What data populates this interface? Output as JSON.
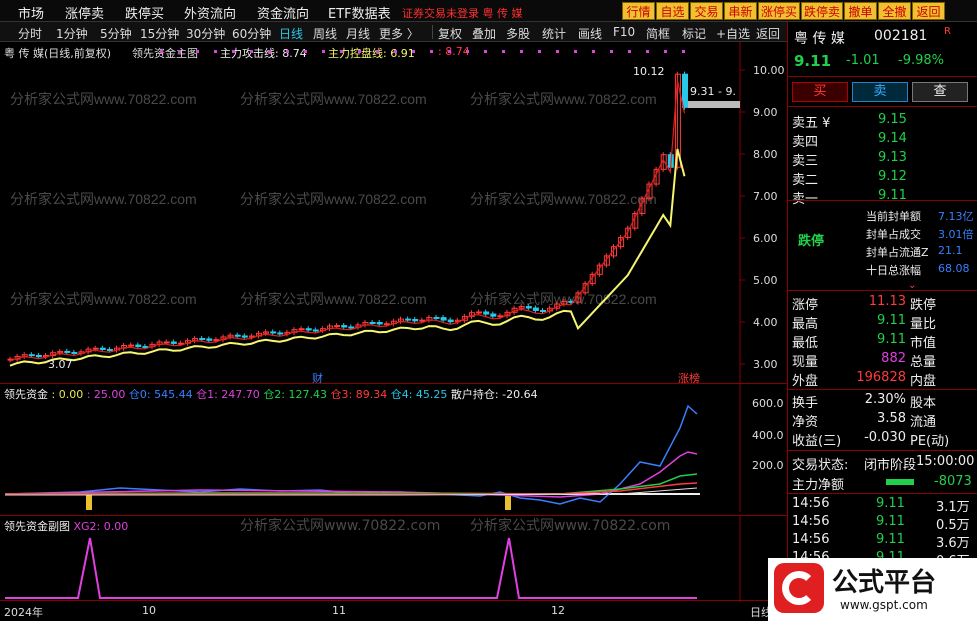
{
  "menu": [
    "市场",
    "涨停卖",
    "跌停买",
    "外资流向",
    "资金流向",
    "ETF数据表"
  ],
  "notice": "证券交易未登录 粤 传 媒",
  "toolbar_buttons": [
    "行情",
    "自选",
    "交易",
    "串新",
    "涨停买",
    "跌停卖",
    "撤单",
    "全撤",
    "返回"
  ],
  "timeframes": [
    "分时",
    "1分钟",
    "5分钟",
    "15分钟",
    "30分钟",
    "60分钟",
    "日线",
    "周线",
    "月线",
    "更多 〉"
  ],
  "actions": [
    "复权",
    "叠加",
    "多股",
    "统计",
    "画线",
    "F10",
    "简框",
    "标记",
    "+自选",
    "返回"
  ],
  "chart_title": "粤 传 媒(日线,前复权)",
  "indicator_main": "领先资金主图",
  "attack_line": "主力攻击线: 8.74",
  "control_line": "主力控盘线: 6.91",
  "control_value": ": 8.74",
  "price_ticks": [
    "10.00",
    "9.00",
    "8.00",
    "7.00",
    "6.00",
    "5.00",
    "4.00",
    "3.00"
  ],
  "peak_label": "10.12",
  "low_label": "3.07",
  "range_label": "9.31 - 9.",
  "cai_label": "财",
  "zhang_label": "涨榜",
  "sub1": {
    "name": "领先资金",
    "values": [
      ": 0.00",
      ": 25.00",
      "仓0: 545.44",
      "仓1: 247.70",
      "仓2: 127.43",
      "仓3: 89.34",
      "仓4: 45.25",
      "散户持仓: -20.64"
    ],
    "ticks": [
      "600.0",
      "400.0",
      "200.0"
    ]
  },
  "sub2": {
    "name": "领先资金副图",
    "value": "XG2: 0.00"
  },
  "xaxis": [
    "2024年",
    "10",
    "11",
    "12",
    "日线"
  ],
  "stock": {
    "name": "粤 传 媒",
    "code": "002181",
    "price": "9.11",
    "change": "-1.01",
    "pct": "-9.98%"
  },
  "trade_btns": [
    "买",
    "卖",
    "查"
  ],
  "book": [
    {
      "label": "卖五 ¥",
      "price": "9.15"
    },
    {
      "label": "卖四",
      "price": "9.14"
    },
    {
      "label": "卖三",
      "price": "9.13"
    },
    {
      "label": "卖二",
      "price": "9.12"
    },
    {
      "label": "卖一",
      "price": "9.11"
    }
  ],
  "limit_info": {
    "tag": "跌停",
    "rows": [
      [
        "当前封单额",
        "7.13亿"
      ],
      [
        "封单占成交",
        "3.01倍"
      ],
      [
        "封单占流通Z",
        "21.1"
      ],
      [
        "十日总涨幅",
        "68.08"
      ]
    ]
  },
  "stats": [
    [
      "涨停",
      "11.13",
      "跌停"
    ],
    [
      "最高",
      "9.11",
      "量比"
    ],
    [
      "最低",
      "9.11",
      "市值"
    ],
    [
      "现量",
      "882",
      "总量"
    ],
    [
      "外盘",
      "196828",
      "内盘"
    ]
  ],
  "stats2": [
    [
      "换手",
      "2.30%",
      "股本"
    ],
    [
      "净资",
      "3.58",
      "流通"
    ],
    [
      "收益(三)",
      "-0.030",
      "PE(动)"
    ]
  ],
  "status": {
    "label": "交易状态:",
    "value": "闭市阶段",
    "time": "15:00:00"
  },
  "net": {
    "label": "主力净额",
    "value": "-8073"
  },
  "ticks": [
    [
      "14:56",
      "9.11",
      "3.1万"
    ],
    [
      "14:56",
      "9.11",
      "0.5万"
    ],
    [
      "14:56",
      "9.11",
      "3.6万"
    ],
    [
      "14:56",
      "9.11",
      "0.6万"
    ]
  ],
  "logo": {
    "text": "公式平台",
    "url": "www.gspt.com"
  },
  "watermark": "分析家公式网www.70822.com",
  "colors": {
    "up": "#ff3b3b",
    "down": "#28c8e8",
    "avg": "#f5f570",
    "bg": "#000000"
  }
}
